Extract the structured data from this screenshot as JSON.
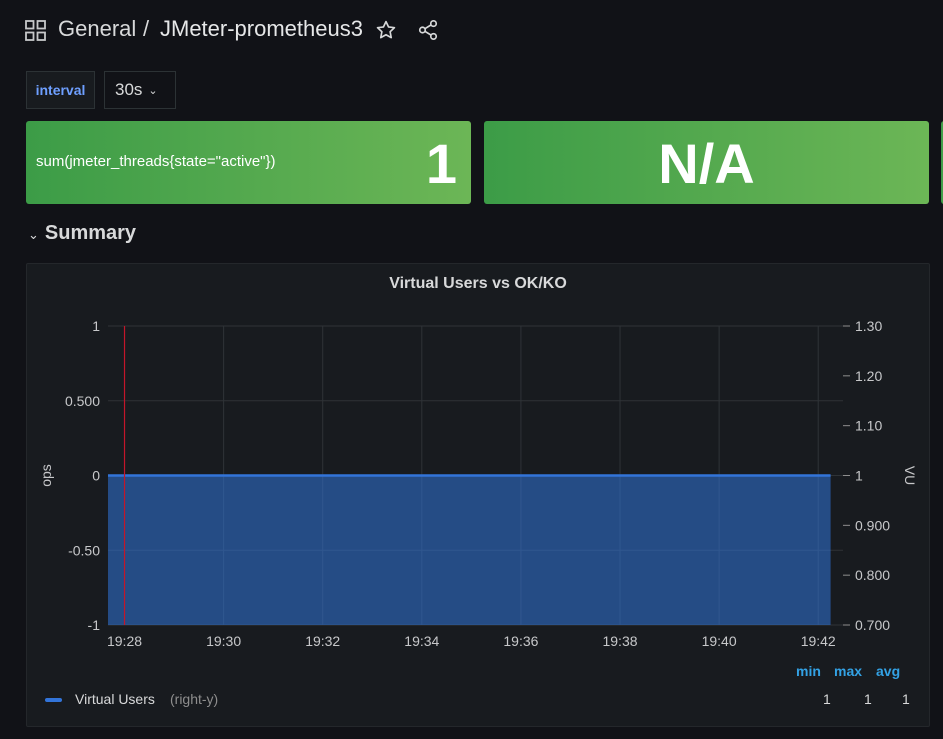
{
  "breadcrumb": {
    "folder": "General",
    "separator": "/",
    "title": "JMeter-prometheus3"
  },
  "variables": {
    "interval_label": "interval",
    "interval_value": "30s"
  },
  "stats": [
    {
      "title": "sum(jmeter_threads{state=\"active\"})",
      "value": "1"
    },
    {
      "title": "",
      "value": "N/A"
    }
  ],
  "row": {
    "title": "Summary"
  },
  "panel": {
    "title": "Virtual Users vs OK/KO",
    "legend": {
      "headers": [
        "min",
        "max",
        "avg"
      ],
      "series_name": "Virtual Users",
      "series_axis": "(right-y)",
      "min": "1",
      "max": "1",
      "avg": "1"
    }
  },
  "chart_data": {
    "type": "area",
    "title": "Virtual Users vs OK/KO",
    "ylabel": "ops",
    "y2label": "VU",
    "x_ticks": [
      "19:28",
      "19:30",
      "19:32",
      "19:34",
      "19:36",
      "19:38",
      "19:40",
      "19:42"
    ],
    "y_ticks": [
      "1",
      "0.500",
      "0",
      "-0.50",
      "-1"
    ],
    "y2_ticks": [
      "1.30",
      "1.20",
      "1.10",
      "1",
      "0.900",
      "0.800",
      "0.700"
    ],
    "ylim": [
      -1,
      1
    ],
    "y2lim": [
      0.7,
      1.3
    ],
    "xlim": [
      "19:27:40",
      "19:42:30"
    ],
    "annotation_x": "19:28",
    "series": [
      {
        "name": "Virtual Users",
        "axis": "right",
        "x": [
          "19:27:40",
          "19:42:15"
        ],
        "values": [
          1,
          1
        ]
      }
    ],
    "colors": {
      "series": "#3274d9",
      "annotation": "#c4162a"
    },
    "grid": true
  }
}
